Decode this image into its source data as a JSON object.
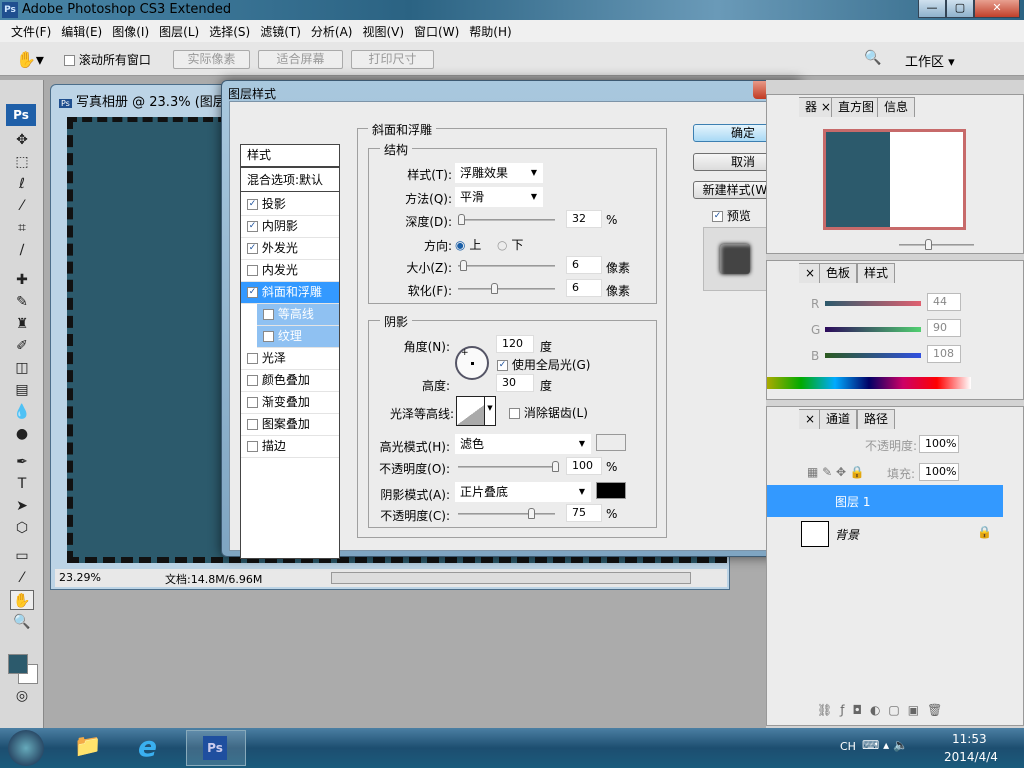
{
  "app": {
    "title": "Adobe Photoshop CS3 Extended",
    "icon": "Ps"
  },
  "window_controls": {
    "minimize": "—",
    "maximize": "▢",
    "close": "✕"
  },
  "menu": [
    "文件(F)",
    "编辑(E)",
    "图像(I)",
    "图层(L)",
    "选择(S)",
    "滤镜(T)",
    "分析(A)",
    "视图(V)",
    "窗口(W)",
    "帮助(H)"
  ],
  "options": {
    "scroll_all": "滚动所有窗口",
    "actual_pixels": "实际像素",
    "fit_screen": "适合屏幕",
    "print_size": "打印尺寸",
    "workspace": "工作区 ▾"
  },
  "document": {
    "title": "写真相册 @ 23.3% (图层",
    "zoom": "23.29%",
    "doc_size": "文档:14.8M/6.96M",
    "canvas_color": "#2c5a6c"
  },
  "dialog": {
    "title": "图层样式",
    "styles_header": "样式",
    "blend_options": "混合选项:默认",
    "styles": [
      {
        "label": "投影",
        "checked": true
      },
      {
        "label": "内阴影",
        "checked": true
      },
      {
        "label": "外发光",
        "checked": true
      },
      {
        "label": "内发光",
        "checked": false
      },
      {
        "label": "斜面和浮雕",
        "checked": true,
        "selected": true
      },
      {
        "label": "等高线",
        "checked": false,
        "sub": true
      },
      {
        "label": "纹理",
        "checked": false,
        "sub": true
      },
      {
        "label": "光泽",
        "checked": false
      },
      {
        "label": "颜色叠加",
        "checked": false
      },
      {
        "label": "渐变叠加",
        "checked": false
      },
      {
        "label": "图案叠加",
        "checked": false
      },
      {
        "label": "描边",
        "checked": false
      }
    ],
    "section_title": "斜面和浮雕",
    "structure": {
      "title": "结构",
      "style_label": "样式(T):",
      "style_value": "浮雕效果",
      "method_label": "方法(Q):",
      "method_value": "平滑",
      "depth_label": "深度(D):",
      "depth_value": "32",
      "depth_unit": "%",
      "direction_label": "方向:",
      "dir_up": "上",
      "dir_down": "下",
      "size_label": "大小(Z):",
      "size_value": "6",
      "size_unit": "像素",
      "soften_label": "软化(F):",
      "soften_value": "6",
      "soften_unit": "像素"
    },
    "shading": {
      "title": "阴影",
      "angle_label": "角度(N):",
      "angle_value": "120",
      "angle_unit": "度",
      "global_light": "使用全局光(G)",
      "altitude_label": "高度:",
      "altitude_value": "30",
      "altitude_unit": "度",
      "gloss_label": "光泽等高线:",
      "anti_alias": "消除锯齿(L)",
      "highlight_label": "高光模式(H):",
      "highlight_mode": "滤色",
      "highlight_color": "#ffffff",
      "hl_opacity_label": "不透明度(O):",
      "hl_opacity": "100",
      "shadow_label": "阴影模式(A):",
      "shadow_mode": "正片叠底",
      "shadow_color": "#000000",
      "sh_opacity_label": "不透明度(C):",
      "sh_opacity": "75",
      "pct": "%"
    },
    "buttons": {
      "ok": "确定",
      "cancel": "取消",
      "new_style": "新建样式(W)...",
      "preview": "预览"
    },
    "close": "✕"
  },
  "panels": {
    "nav_tabs": [
      "器 ×",
      "直方图",
      "信息"
    ],
    "color_tabs": [
      "×",
      "色板",
      "样式"
    ],
    "color": {
      "r_label": "R",
      "r": "44",
      "g_label": "G",
      "g": "90",
      "b_label": "B",
      "b": "108"
    },
    "layer_tabs": [
      "×",
      "通道",
      "路径"
    ],
    "opacity_label": "不透明度:",
    "opacity": "100%",
    "fill_label": "填充:",
    "fill": "100%",
    "layers": [
      {
        "name": "图层 1",
        "selected": true
      },
      {
        "name": "背景",
        "locked": true
      }
    ]
  },
  "taskbar": {
    "lang": "CH",
    "time": "11:53",
    "date": "2014/4/4",
    "ps": "Ps"
  }
}
